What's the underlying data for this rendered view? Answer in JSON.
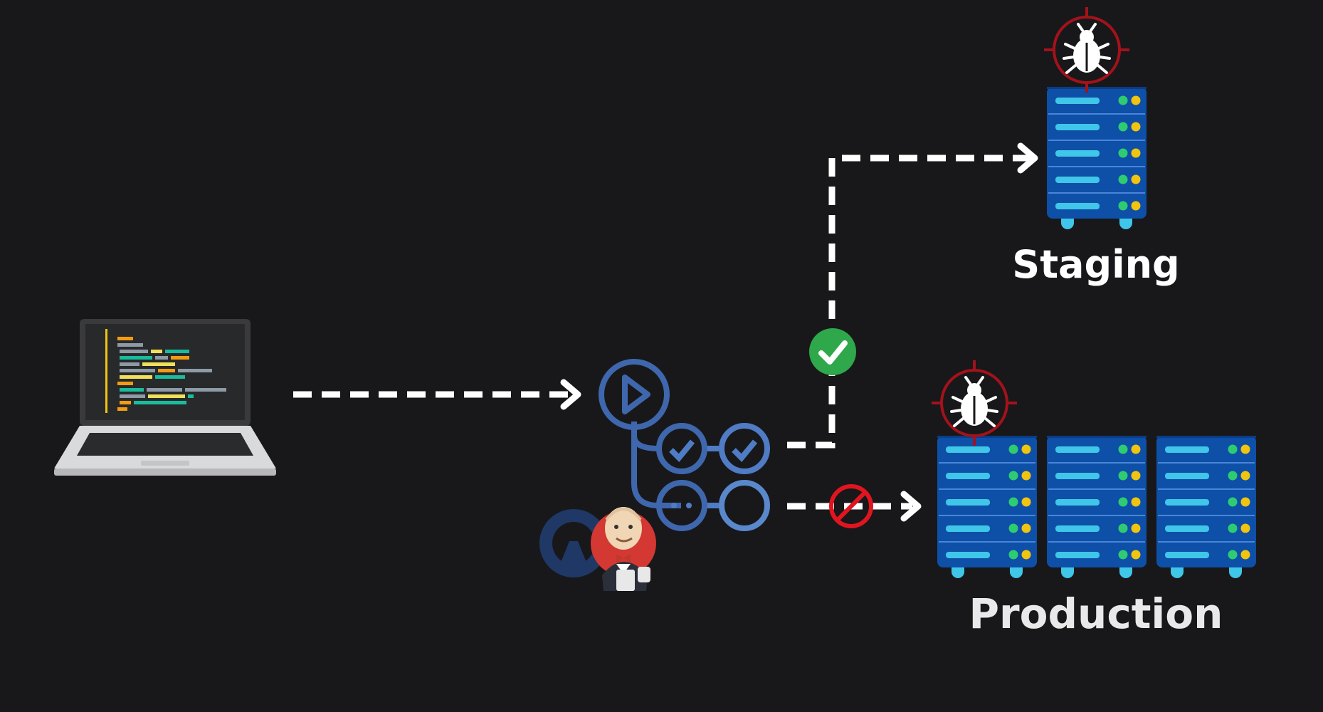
{
  "labels": {
    "staging": "Staging",
    "production": "Production"
  },
  "icons": {
    "laptop": "laptop-code-icon",
    "pipeline": "github-actions-pipeline-icon",
    "github": "github-octocat-icon",
    "jenkins": "jenkins-butler-icon",
    "approved": "check-circle-icon",
    "blocked": "prohibited-icon",
    "bug": "bug-icon",
    "server": "server-rack-icon"
  },
  "colors": {
    "background": "#18181a",
    "arrow": "#ffffff",
    "pipeline_blue": "#4f7cc4",
    "server_body": "#0e4fa8",
    "server_bar": "#3fc6e8",
    "led_green": "#2ecc71",
    "led_yellow": "#f1c40f",
    "check_green": "#2ea84a",
    "block_red": "#e0151f",
    "target_red": "#a3121b"
  }
}
